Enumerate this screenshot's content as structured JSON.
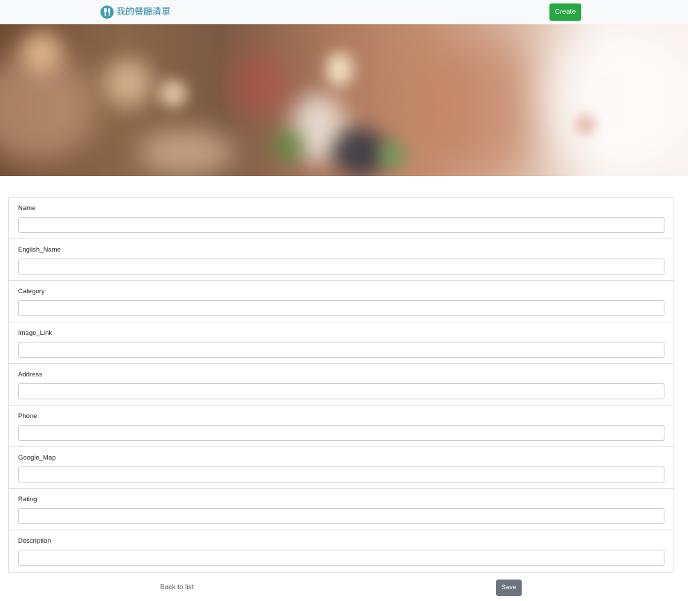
{
  "navbar": {
    "brand_icon": "utensils-icon",
    "brand_title": "我的餐廳清單",
    "create_label": "Create"
  },
  "banner": {
    "description_icon": "restaurant-banner-image"
  },
  "form": {
    "fields": [
      {
        "label": "Name",
        "value": ""
      },
      {
        "label": "English_Name",
        "value": ""
      },
      {
        "label": "Category",
        "value": ""
      },
      {
        "label": "Image_Link",
        "value": ""
      },
      {
        "label": "Address",
        "value": ""
      },
      {
        "label": "Phone",
        "value": ""
      },
      {
        "label": "Google_Map",
        "value": ""
      },
      {
        "label": "Rating",
        "value": ""
      },
      {
        "label": "Description",
        "value": ""
      }
    ]
  },
  "footer": {
    "back_label": "Back to list",
    "save_label": "Save"
  },
  "colors": {
    "navbar_bg": "#f8f9fa",
    "brand": "#2e8ba8",
    "create_button": "#28a745",
    "save_button": "#6c757d"
  }
}
